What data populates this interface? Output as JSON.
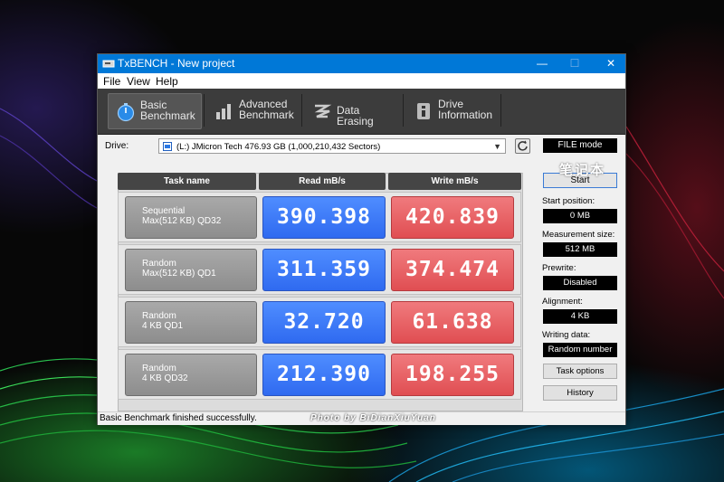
{
  "window": {
    "title": "TxBENCH - New project",
    "controls": {
      "minimize": "—",
      "maximize": "☐",
      "close": "✕"
    }
  },
  "menu": [
    "File",
    "View",
    "Help"
  ],
  "toolbar": {
    "tabs": [
      {
        "label": "Basic\nBenchmark",
        "icon": "stopwatch-icon",
        "active": true
      },
      {
        "label": "Advanced\nBenchmark",
        "icon": "bar-chart-icon",
        "active": false
      },
      {
        "label": "Data Erasing",
        "icon": "eraser-icon",
        "active": false
      },
      {
        "label": "Drive\nInformation",
        "icon": "drive-info-icon",
        "active": false
      }
    ]
  },
  "drive": {
    "label": "Drive:",
    "value": "(L:) JMicron Tech  476.93 GB (1,000,210,432 Sectors)"
  },
  "table": {
    "headers": [
      "Task name",
      "Read mB/s",
      "Write mB/s"
    ],
    "rows": [
      {
        "task": "Sequential\nMax(512 KB) QD32",
        "read": "390.398",
        "write": "420.839"
      },
      {
        "task": "Random\nMax(512 KB) QD1",
        "read": "311.359",
        "write": "374.474"
      },
      {
        "task": "Random\n4 KB QD1",
        "read": "32.720",
        "write": "61.638"
      },
      {
        "task": "Random\n4 KB QD32",
        "read": "212.390",
        "write": "198.255"
      }
    ]
  },
  "side": {
    "mode": "FILE mode",
    "start_button": "Start",
    "start_position_label": "Start position:",
    "start_position": "0 MB",
    "measurement_size_label": "Measurement size:",
    "measurement_size": "512 MB",
    "prewrite_label": "Prewrite:",
    "prewrite": "Disabled",
    "alignment_label": "Alignment:",
    "alignment": "4 KB",
    "writing_data_label": "Writing data:",
    "writing_data": "Random number",
    "task_options_button": "Task options",
    "history_button": "History"
  },
  "status": {
    "text": "Basic Benchmark finished successfully.",
    "watermark": "Photo by BiDianXiuYuan",
    "watermark_cn": "笔记本"
  },
  "colors": {
    "titlebar": "#0078d7",
    "read": "#3a78f5",
    "write": "#e8595d",
    "toolbar": "#3c3c3c"
  }
}
